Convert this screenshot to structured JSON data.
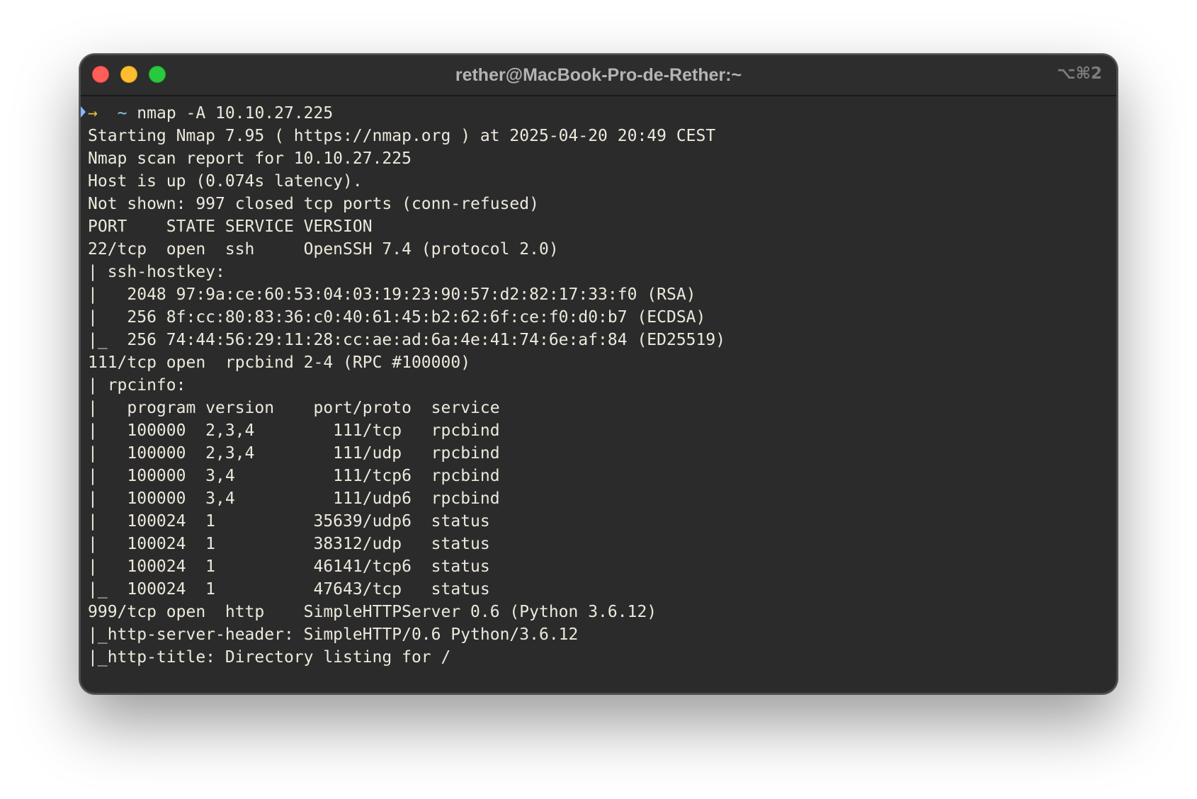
{
  "window": {
    "title": "rether@MacBook-Pro-de-Rether:~",
    "shortcut": "⌥⌘2"
  },
  "prompt": {
    "arrow": "→",
    "cwd": "~",
    "command": "nmap -A 10.10.27.225"
  },
  "output": {
    "lines": [
      "Starting Nmap 7.95 ( https://nmap.org ) at 2025-04-20 20:49 CEST",
      "Nmap scan report for 10.10.27.225",
      "Host is up (0.074s latency).",
      "Not shown: 997 closed tcp ports (conn-refused)",
      "PORT    STATE SERVICE VERSION",
      "22/tcp  open  ssh     OpenSSH 7.4 (protocol 2.0)",
      "| ssh-hostkey:",
      "|   2048 97:9a:ce:60:53:04:03:19:23:90:57:d2:82:17:33:f0 (RSA)",
      "|   256 8f:cc:80:83:36:c0:40:61:45:b2:62:6f:ce:f0:d0:b7 (ECDSA)",
      "|_  256 74:44:56:29:11:28:cc:ae:ad:6a:4e:41:74:6e:af:84 (ED25519)",
      "111/tcp open  rpcbind 2-4 (RPC #100000)",
      "| rpcinfo:",
      "|   program version    port/proto  service",
      "|   100000  2,3,4        111/tcp   rpcbind",
      "|   100000  2,3,4        111/udp   rpcbind",
      "|   100000  3,4          111/tcp6  rpcbind",
      "|   100000  3,4          111/udp6  rpcbind",
      "|   100024  1          35639/udp6  status",
      "|   100024  1          38312/udp   status",
      "|   100024  1          46141/tcp6  status",
      "|_  100024  1          47643/tcp   status",
      "999/tcp open  http    SimpleHTTPServer 0.6 (Python 3.6.12)",
      "|_http-server-header: SimpleHTTP/0.6 Python/3.6.12",
      "|_http-title: Directory listing for /"
    ]
  },
  "colors": {
    "background": "#2b2b2b",
    "text": "#ece9dc",
    "prompt_arrow": "#e3c04a",
    "prompt_cwd": "#8fc7e6",
    "close": "#ff5f57",
    "minimize": "#febc2e",
    "zoom": "#28c840"
  }
}
